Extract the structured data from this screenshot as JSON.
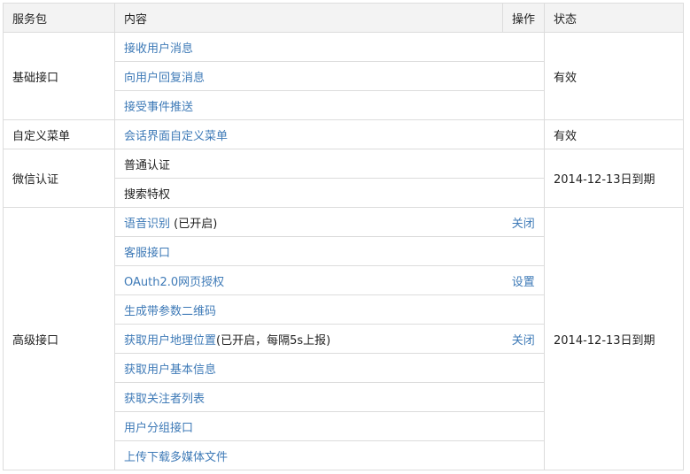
{
  "header": {
    "package": "服务包",
    "content": "内容",
    "operation": "操作",
    "status": "状态"
  },
  "groups": [
    {
      "name": "基础接口",
      "status": "有效",
      "items": [
        {
          "label": "接收用户消息",
          "suffix": "",
          "action": "",
          "link": true
        },
        {
          "label": "向用户回复消息",
          "suffix": "",
          "action": "",
          "link": true
        },
        {
          "label": "接受事件推送",
          "suffix": "",
          "action": "",
          "link": true
        }
      ]
    },
    {
      "name": "自定义菜单",
      "status": "有效",
      "items": [
        {
          "label": "会话界面自定义菜单",
          "suffix": "",
          "action": "",
          "link": true
        }
      ]
    },
    {
      "name": "微信认证",
      "status": "2014-12-13日到期",
      "items": [
        {
          "label": "普通认证",
          "suffix": "",
          "action": "",
          "link": false
        },
        {
          "label": "搜索特权",
          "suffix": "",
          "action": "",
          "link": false
        }
      ]
    },
    {
      "name": "高级接口",
      "status": "2014-12-13日到期",
      "items": [
        {
          "label": "语音识别",
          "suffix": " (已开启)",
          "action": "关闭",
          "link": true
        },
        {
          "label": "客服接口",
          "suffix": "",
          "action": "",
          "link": true
        },
        {
          "label": "OAuth2.0网页授权",
          "suffix": "",
          "action": "设置",
          "link": true
        },
        {
          "label": "生成带参数二维码",
          "suffix": "",
          "action": "",
          "link": true
        },
        {
          "label": "获取用户地理位置",
          "suffix": "(已开启，每隔5s上报)",
          "action": "关闭",
          "link": true
        },
        {
          "label": "获取用户基本信息",
          "suffix": "",
          "action": "",
          "link": true
        },
        {
          "label": "获取关注者列表",
          "suffix": "",
          "action": "",
          "link": true
        },
        {
          "label": "用户分组接口",
          "suffix": "",
          "action": "",
          "link": true
        },
        {
          "label": "上传下载多媒体文件",
          "suffix": "",
          "action": "",
          "link": true
        }
      ]
    }
  ]
}
